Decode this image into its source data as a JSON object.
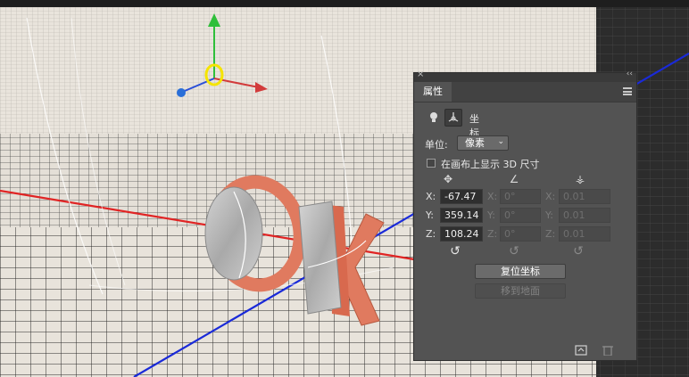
{
  "panel": {
    "close_glyph": "×",
    "collapse_glyph": "‹‹",
    "tab_label": "属性",
    "menu_icon": "hamburger-menu-icon",
    "section_title": "坐标",
    "unit_label": "单位:",
    "unit_value": "像素",
    "show_size_label": "在画布上显示 3D 尺寸",
    "position": {
      "x": "-67.47",
      "y": "359.14",
      "z": "108.24"
    },
    "rotation": {
      "x": "0°",
      "y": "0°",
      "z": "0°"
    },
    "scale": {
      "x": "0.01",
      "y": "0.01",
      "z": "0.01"
    },
    "axis_labels": {
      "x": "X:",
      "y": "Y:",
      "z": "Z:"
    },
    "reset_coords_label": "复位坐标",
    "move_to_ground_label": "移到地面"
  },
  "colors": {
    "panel_bg": "#535353",
    "x_axis": "#e02424",
    "z_axis": "#1a2ad8",
    "gizmo_y": "#2fbf3a",
    "gizmo_ring": "#f5e400",
    "letter_orange": "#e07a5f"
  }
}
